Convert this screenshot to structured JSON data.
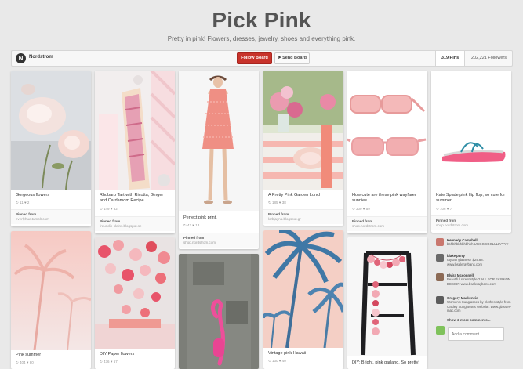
{
  "board": {
    "title": "Pick Pink",
    "description": "Pretty in pink! Flowers, dresses, jewelry, shoes and everything pink.",
    "owner": "Nordstrom",
    "follow_label": "Follow Board",
    "send_label": "Send Board",
    "pins_count": "319 Pins",
    "followers_count": "202,221 Followers"
  },
  "pins": [
    {
      "desc": "Gorgeous flowers",
      "stats": "↻ 11  ♥ 2",
      "pinned_from_label": "Pinned from",
      "source": "everlyhue.tumblr.com"
    },
    {
      "desc": "Rhubarb Tart with Ricotta, Ginger and Cardamom Recipe",
      "stats": "↻ 149  ♥ 32",
      "pinned_from_label": "Pinned from",
      "source": "freundin-kleins.blogspot.se"
    },
    {
      "desc": "Perfect pink print.",
      "stats": "↻ 42  ♥ 13",
      "pinned_from_label": "Pinned from",
      "source": "shop.nordstrom.com"
    },
    {
      "desc": "A Pretty Pink Garden Lunch",
      "stats": "↻ 185  ♥ 38",
      "pinned_from_label": "Pinned from",
      "source": "lorbjayna.blogspot.gr"
    },
    {
      "desc": "How cute are these pink wayfarer sunnies",
      "stats": "↻ 300  ♥ 59",
      "pinned_from_label": "Pinned from",
      "source": "shop.nordstrom.com"
    },
    {
      "desc": "Kate Spade pink flip flop, so cute for summer!",
      "stats": "↻ 106  ♥ 7",
      "pinned_from_label": "Pinned from",
      "source": "shop.nordstrom.com"
    },
    {
      "desc": "Pink summer",
      "stats": "↻ 404  ♥ 80"
    },
    {
      "desc": "DIY Paper flowers",
      "stats": "↻ 436  ♥ 67"
    },
    {
      "desc": "Vintage pink Hawaii",
      "stats": "↻ 130  ♥ 40"
    },
    {
      "desc": "DIY: Bright, pink garland. So pretty!"
    }
  ],
  "comments": [
    {
      "author": "Kennedy Campbell",
      "text": "bbhbhbbhbhbhbh UGGGGGGLLLLYYYY"
    },
    {
      "author": "blake parry",
      "text": "rayban glasses!! $24.88. www.bsaleraybans.com"
    },
    {
      "author": "Elvira Mcconnell",
      "text": "Beautiful street style ? ALL FOR FASHION DESIGN www.bsaleraybans.com"
    },
    {
      "author": "Gregory Mackenzie",
      "text": "Women's Sunglasses by clothes style from Oakley Sunglasses Website. www.glasses-mac.com"
    }
  ],
  "show_more": "Show 2 more comments...",
  "add_comment_placeholder": "Add a comment...",
  "colors": {
    "brand_red": "#c8332b",
    "background": "#e9e9e9"
  }
}
